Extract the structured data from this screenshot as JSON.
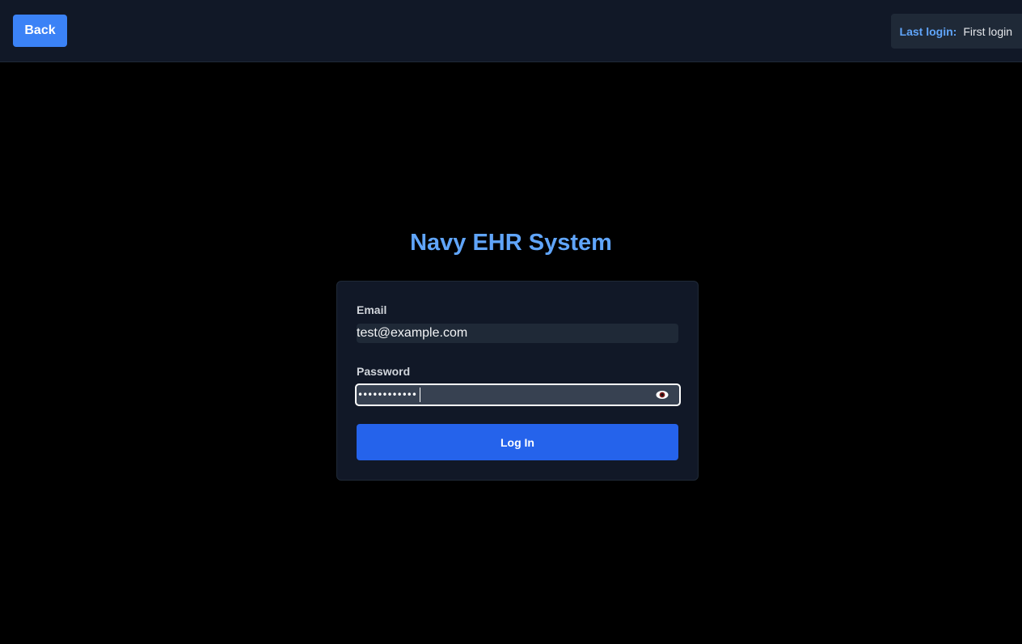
{
  "header": {
    "back_label": "Back",
    "last_login_label": "Last login:",
    "last_login_value": "First login"
  },
  "app": {
    "title": "Navy EHR System"
  },
  "form": {
    "email_label": "Email",
    "email_value": "test@example.com",
    "password_label": "Password",
    "password_masked": "••••••••••••",
    "toggle_icon": "eye-icon",
    "submit_label": "Log In"
  },
  "colors": {
    "accent": "#3b82f6",
    "title": "#60a5fa",
    "primary_button": "#2563eb",
    "background": "#000000",
    "surface": "#111827"
  }
}
